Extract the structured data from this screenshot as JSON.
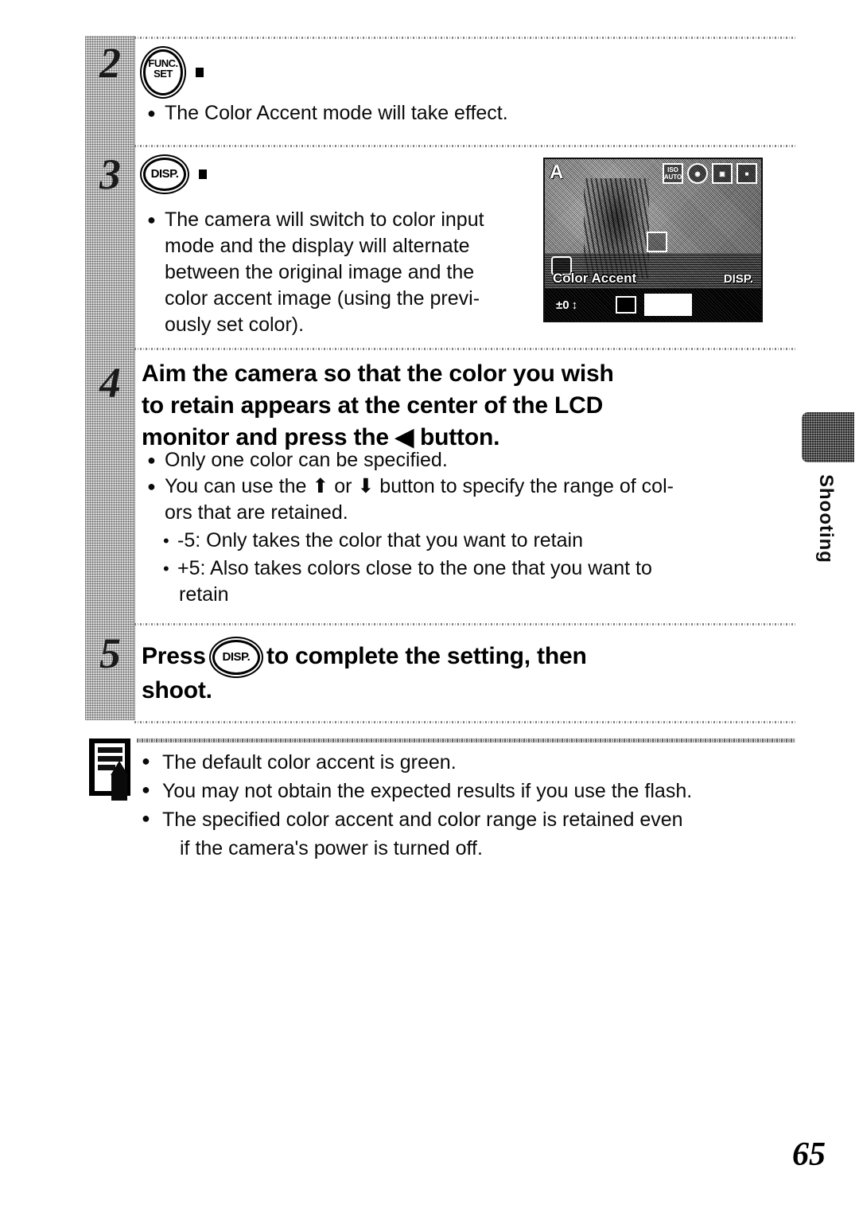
{
  "page": {
    "number": "65",
    "side_tab_label": "Shooting"
  },
  "steps": [
    {
      "number": "2",
      "button": {
        "line1": "FUNC.",
        "line2": "SET",
        "type": "func-set-button"
      },
      "bullets": [
        "The Color Accent mode will take effect."
      ]
    },
    {
      "number": "3",
      "button": {
        "label": "DISP.",
        "type": "disp-button"
      },
      "bullets": [
        "The camera will switch to color input",
        "mode and the display will alternate",
        "between the original image and the",
        "color accent image (using the previ-",
        "ously set color)."
      ]
    },
    {
      "number": "4",
      "heading_lines": [
        "Aim the camera so that the color you wish",
        "to retain appears at the center of the LCD",
        "monitor and press the ◀ button."
      ],
      "bullets": [
        "Only one color can be specified.",
        "You can use the ⬆ or ⬇ button to specify the range of col-",
        "ors that are retained."
      ],
      "sub_bullets": [
        "-5: Only takes the color that you want to retain",
        "+5: Also takes colors close to the one that you want to",
        "retain"
      ]
    },
    {
      "number": "5",
      "heading_before": "Press",
      "heading_button": "DISP.",
      "heading_after": "to complete the setting, then",
      "heading_line2": "shoot."
    }
  ],
  "lcd": {
    "mode_icon": "A",
    "iso_label_top": "ISO",
    "iso_label_bottom": "AUTO",
    "wb_icon": "white-balance-icon",
    "metering_icon": "metering-icon",
    "battery_icon": "battery-icon",
    "mode_label": "Color Accent",
    "disp_tag": "DISP.",
    "exposure_indicator": "±0",
    "color_swatch_label": ""
  },
  "notes": {
    "icon": "memo-pencil-icon",
    "items": [
      "The default color accent is green.",
      "You may not obtain the expected results if you use the flash.",
      "The specified color accent and color range is retained even",
      "if the camera's power is turned off."
    ]
  }
}
